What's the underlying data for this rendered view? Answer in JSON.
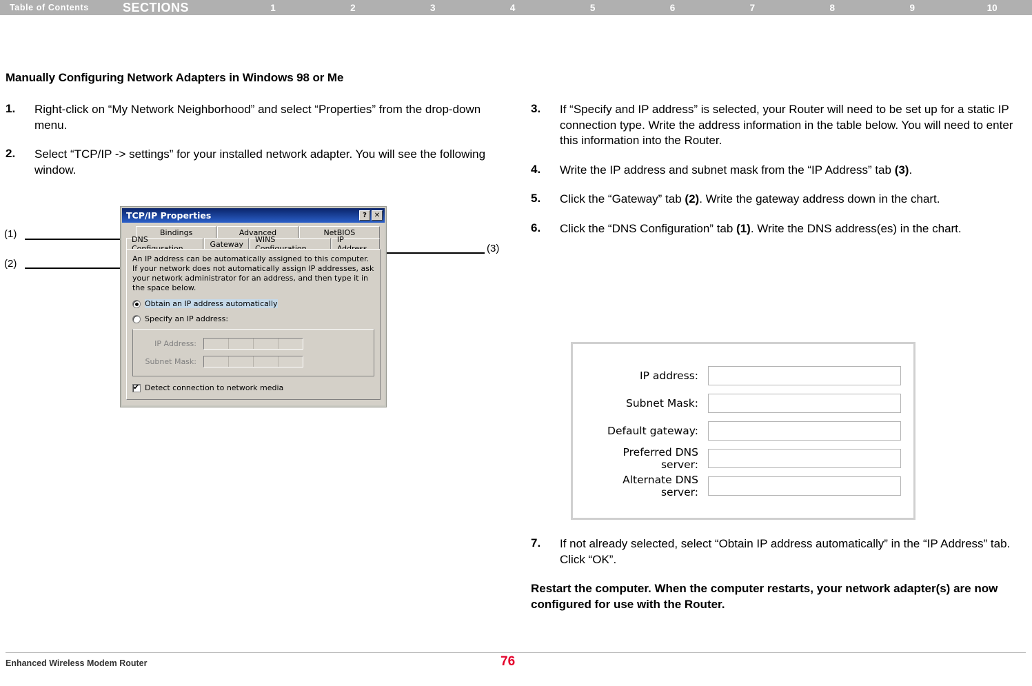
{
  "topbar": {
    "toc_label": "Table of Contents",
    "sections_label": "SECTIONS",
    "section_numbers": [
      "1",
      "2",
      "3",
      "4",
      "5",
      "6",
      "7",
      "8",
      "9",
      "10"
    ],
    "active_section": "7"
  },
  "page_title": "Manually Configuring Network Adapters in Windows 98 or Me",
  "left_steps": [
    {
      "num": "1.",
      "text": "Right-click on “My Network Neighborhood” and select “Properties” from the drop-down menu."
    },
    {
      "num": "2.",
      "text": "Select “TCP/IP -> settings” for your installed network adapter. You will see the following window."
    }
  ],
  "right_steps": [
    {
      "num": "3.",
      "text": "If “Specify and IP address” is selected, your Router will need to be set up for a static IP connection type. Write the address information in the table below. You will need to enter this information into the Router."
    },
    {
      "num": "4.",
      "text_pre": "Write the IP address and subnet mask from the “IP Address” tab ",
      "bold": "(3)",
      "text_post": "."
    },
    {
      "num": "5.",
      "text_pre": "Click the “Gateway” tab ",
      "bold": "(2)",
      "text_post": ". Write the gateway address down in the chart."
    },
    {
      "num": "6.",
      "text_pre": "Click the “DNS Configuration” tab ",
      "bold": "(1)",
      "text_post": ". Write the DNS address(es) in the chart."
    },
    {
      "num": "7.",
      "text": "If not already selected, select “Obtain IP address automatically” in the “IP Address” tab. Click “OK”."
    }
  ],
  "closing_note": "Restart the computer. When the computer restarts, your network adapter(s) are now configured for use with the Router.",
  "callouts": {
    "one": "(1)",
    "two": "(2)",
    "three": "(3)"
  },
  "dialog": {
    "title": "TCP/IP Properties",
    "help_button": "?",
    "close_button": "✕",
    "tabs_row1": [
      "Bindings",
      "Advanced",
      "NetBIOS"
    ],
    "tabs_row2": [
      "DNS Configuration",
      "Gateway",
      "WINS Configuration",
      "IP Address"
    ],
    "selected_tab": "IP Address",
    "description": "An IP address can be automatically assigned to this computer. If your network does not automatically assign IP addresses, ask your network administrator for an address, and then type it in the space below.",
    "radio_auto": "Obtain an IP address automatically",
    "radio_specify": "Specify an IP address:",
    "field_ip_label": "IP Address:",
    "field_subnet_label": "Subnet Mask:",
    "checkbox_label": "Detect connection to network media"
  },
  "form_image": {
    "rows": [
      {
        "label": "IP address:",
        "value": ""
      },
      {
        "label": "Subnet Mask:",
        "value": ""
      },
      {
        "label": "Default gateway:",
        "value": ""
      },
      {
        "label": "Preferred DNS server:",
        "value": ""
      },
      {
        "label": "Alternate DNS server:",
        "value": ""
      }
    ]
  },
  "footer": {
    "product": "Enhanced Wireless Modem Router",
    "page_number": "76",
    "page_color": "#e4002b"
  }
}
